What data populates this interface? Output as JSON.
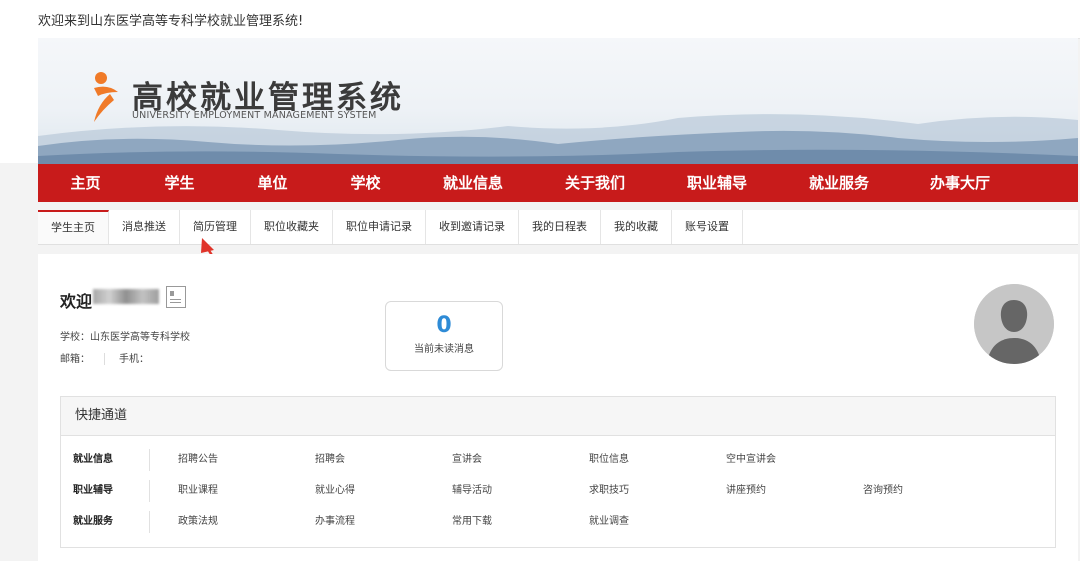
{
  "topbar": {
    "welcome": "欢迎来到山东医学高等专科学校就业管理系统!"
  },
  "banner": {
    "title": "高校就业管理系统",
    "subtitle": "UNIVERSITY EMPLOYMENT MANAGEMENT SYSTEM",
    "logo_color": "#f07a28"
  },
  "nav": {
    "items": [
      "主页",
      "学生",
      "单位",
      "学校",
      "就业信息",
      "关于我们",
      "职业辅导",
      "就业服务",
      "办事大厅"
    ],
    "color": "#c81b1b"
  },
  "subtabs": {
    "items": [
      "学生主页",
      "消息推送",
      "简历管理",
      "职位收藏夹",
      "职位申请记录",
      "收到邀请记录",
      "我的日程表",
      "我的收藏",
      "账号设置"
    ],
    "active_index": 0
  },
  "profile": {
    "greeting": "欢迎",
    "school": "学校：山东医学高等专科学校",
    "email_label": "邮箱：",
    "phone_label": "手机："
  },
  "unread": {
    "count": "0",
    "caption": "当前未读消息"
  },
  "quick": {
    "title": "快捷通道",
    "rows": [
      {
        "category": "就业信息",
        "links": [
          "招聘公告",
          "招聘会",
          "宣讲会",
          "职位信息",
          "空中宣讲会"
        ]
      },
      {
        "category": "职业辅导",
        "links": [
          "职业课程",
          "就业心得",
          "辅导活动",
          "求职技巧",
          "讲座预约",
          "咨询预约"
        ]
      },
      {
        "category": "就业服务",
        "links": [
          "政策法规",
          "办事流程",
          "常用下载",
          "就业调查"
        ]
      }
    ]
  },
  "colors": {
    "accent": "#c81b1b",
    "unread_count": "#2e8bd6",
    "arrow": "#e0342a"
  }
}
